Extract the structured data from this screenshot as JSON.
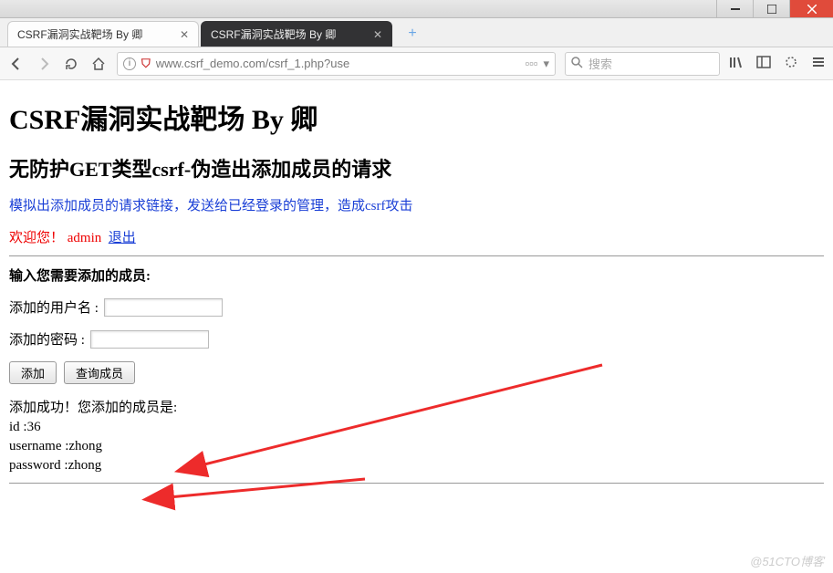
{
  "window": {
    "tabs": [
      {
        "title": "CSRF漏洞实战靶场 By 卿",
        "active": true
      },
      {
        "title": "CSRF漏洞实战靶场 By 卿",
        "active": false
      }
    ]
  },
  "addressbar": {
    "url": "www.csrf_demo.com/csrf_1.php?use",
    "search_placeholder": "搜索"
  },
  "page": {
    "h1": "CSRF漏洞实战靶场 By 卿",
    "h2": "无防护GET类型csrf-伪造出添加成员的请求",
    "desc_blue": "模拟出添加成员的请求链接，发送给已经登录的管理，造成csrf攻击",
    "welcome_prefix": "欢迎您！ ",
    "welcome_user": "admin",
    "logout_label": "退出",
    "form_title": "输入您需要添加的成员:",
    "username_label": "添加的用户名 :",
    "password_label": "添加的密码 :",
    "add_btn": "添加",
    "query_btn": "查询成员",
    "result_success": "添加成功！您添加的成员是:",
    "result_id_label": "id :",
    "result_id_value": "36",
    "result_username_label": "username :",
    "result_username_value": "zhong",
    "result_password_label": "password :",
    "result_password_value": "zhong"
  },
  "watermark": "@51CTO博客"
}
